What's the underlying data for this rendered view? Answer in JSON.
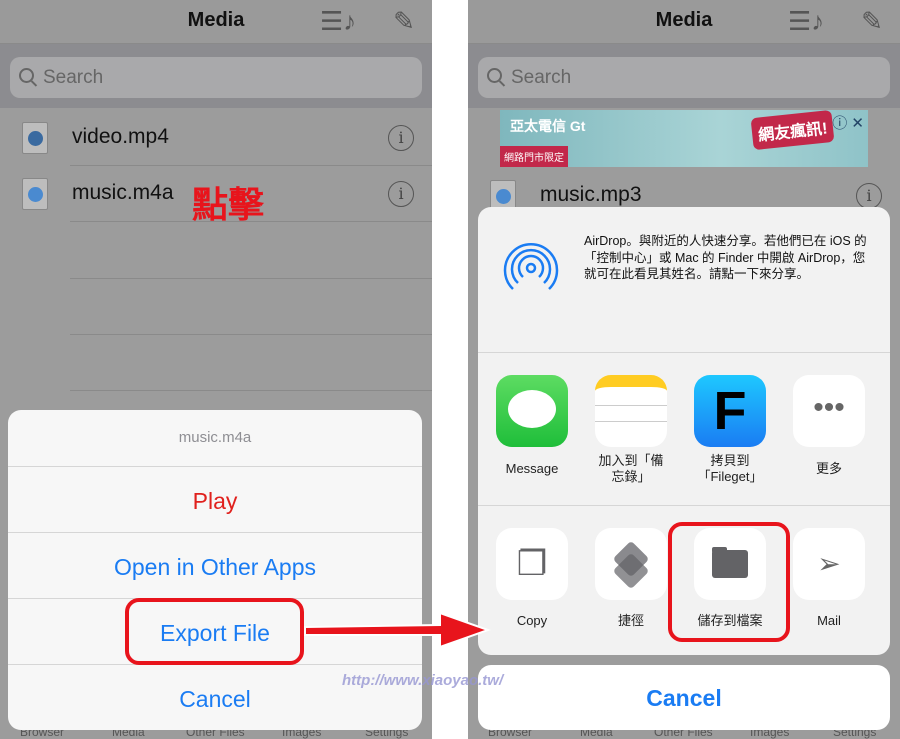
{
  "left": {
    "nav": {
      "title": "Media",
      "playlist_icon": "music-list-icon",
      "edit_icon": "compose-icon"
    },
    "search": {
      "placeholder": "Search"
    },
    "files": [
      {
        "name": "video.mp4",
        "icon": "quicktime-file-icon"
      },
      {
        "name": "music.m4a",
        "icon": "music-file-icon"
      }
    ],
    "annotation": "點擊",
    "action_sheet": {
      "title": "music.m4a",
      "options": [
        "Play",
        "Open in Other Apps",
        "Export File"
      ],
      "cancel": "Cancel",
      "play_color": "#e0211d",
      "accent": "#1a7cf3"
    },
    "tabs": [
      "Browser",
      "Media",
      "Other Files",
      "Images",
      "Settings"
    ]
  },
  "right": {
    "nav": {
      "title": "Media"
    },
    "search": {
      "placeholder": "Search"
    },
    "ad": {
      "brand": "亞太電信 Gt",
      "tag": "網路門市限定",
      "headline": "網友瘋訊!"
    },
    "files": [
      {
        "name": "music.mp3"
      }
    ],
    "share_sheet": {
      "airdrop_text": "AirDrop。與附近的人快速分享。若他們已在 iOS 的「控制中心」或 Mac 的 Finder 中開啟 AirDrop，您就可在此看見其姓名。請點一下來分享。",
      "apps": [
        {
          "label": "Message",
          "icon": "messages-icon"
        },
        {
          "label": "加入到「備忘錄」",
          "icon": "notes-icon"
        },
        {
          "label": "拷貝到「Fileget」",
          "icon": "fileget-icon"
        },
        {
          "label": "更多",
          "icon": "more-icon"
        }
      ],
      "actions": [
        {
          "label": "Copy",
          "icon": "copy-icon"
        },
        {
          "label": "捷徑",
          "icon": "shortcuts-icon"
        },
        {
          "label": "儲存到檔案",
          "icon": "folder-icon"
        },
        {
          "label": "Mail",
          "icon": "send-icon"
        }
      ],
      "cancel": "Cancel"
    },
    "tabs": [
      "Browser",
      "Media",
      "Other Files",
      "Images",
      "Settings"
    ]
  },
  "watermark": "http://www.xiaoyao.tw/",
  "annotation_color": "#e8141c"
}
